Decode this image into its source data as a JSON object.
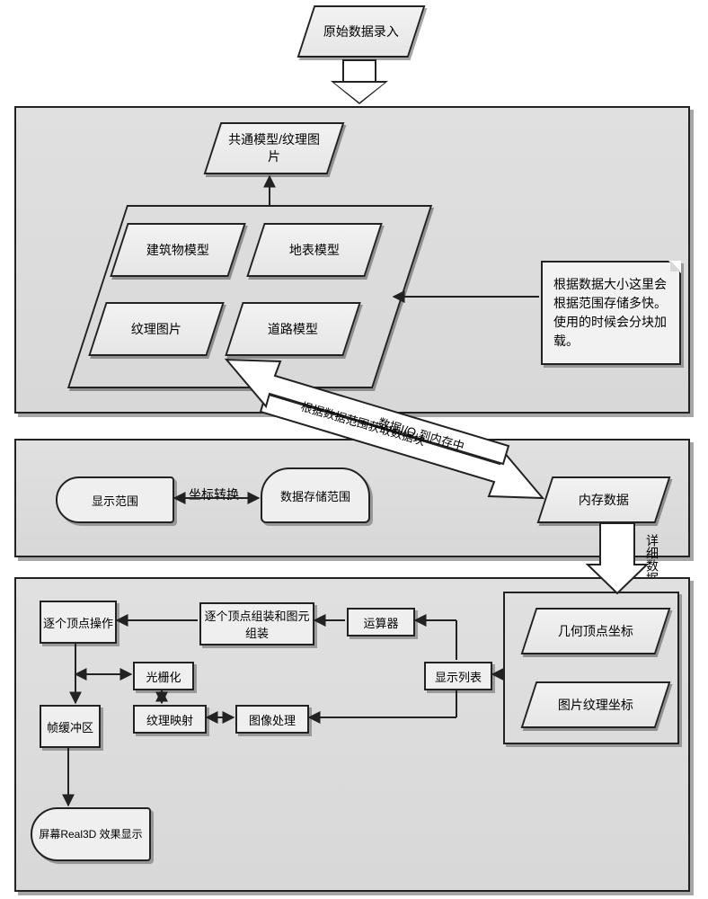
{
  "top": {
    "input": "原始数据录入"
  },
  "storage": {
    "common_model_texture": "共通模型/纹理图片",
    "items": {
      "building_model": "建筑物模型",
      "terrain_model": "地表模型",
      "texture_image": "纹理图片",
      "road_model": "道路模型"
    },
    "note": "根据数据大小这里会根据范围存储多快。使用的时候会分块加载。"
  },
  "bridge": {
    "label_left": "根据数据范围获取数据块",
    "label_right": "数据I/O 到内存中"
  },
  "middle": {
    "display_range": "显示范围",
    "coord_transform": "坐标转换",
    "data_storage_range": "数据存储范围",
    "memory_data": "内存数据",
    "detail_data": "详细数据"
  },
  "render": {
    "geometry_vertex_coords": "几何顶点坐标",
    "image_texture_coords": "图片纹理坐标",
    "display_list": "显示列表",
    "calculator": "运算器",
    "vertex_assembly": "逐个顶点组装和图元组装",
    "per_vertex_op": "逐个顶点操作",
    "rasterize": "光栅化",
    "texture_mapping": "纹理映射",
    "image_processing": "图像处理",
    "framebuffer": "帧缓冲区",
    "screen_display": "屏幕Real3D 效果显示"
  }
}
